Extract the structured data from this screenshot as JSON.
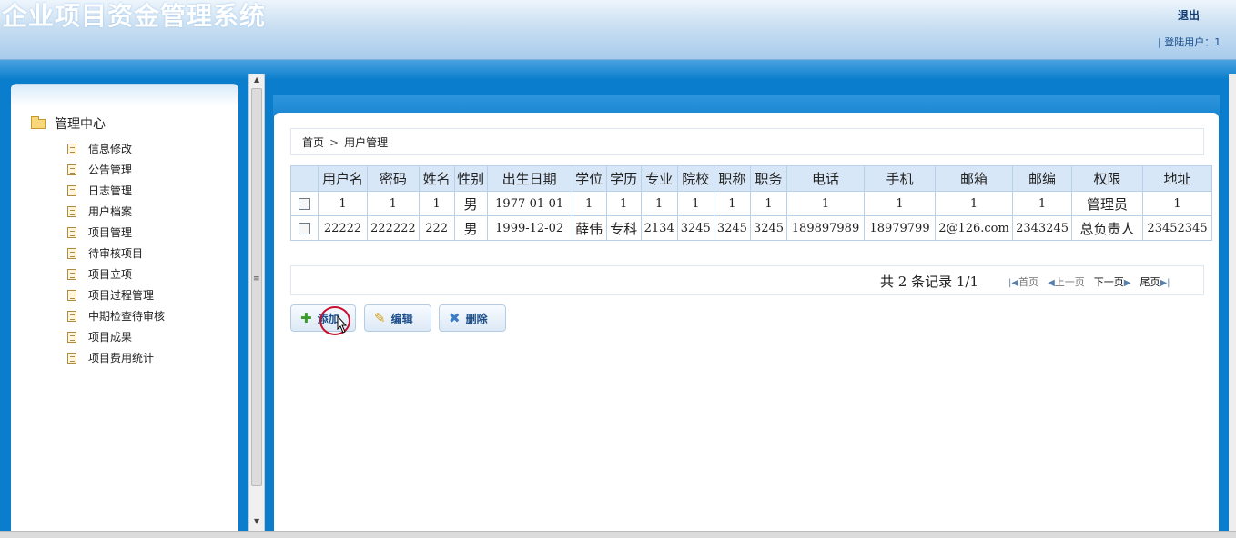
{
  "header": {
    "title": "企业项目资金管理系统",
    "logout_label": "退出",
    "login_user_text": "| 登陆用户：1"
  },
  "sidebar": {
    "root_label": "管理中心",
    "items": [
      {
        "label": "信息修改"
      },
      {
        "label": "公告管理"
      },
      {
        "label": "日志管理"
      },
      {
        "label": "用户档案"
      },
      {
        "label": "项目管理"
      },
      {
        "label": "待审核项目"
      },
      {
        "label": "项目立项"
      },
      {
        "label": "项目过程管理"
      },
      {
        "label": "中期检查待审核"
      },
      {
        "label": "项目成果"
      },
      {
        "label": "项目费用统计"
      }
    ]
  },
  "breadcrumb": {
    "home": "首页",
    "separator": ">",
    "current": "用户管理"
  },
  "table": {
    "headers": [
      "用户名",
      "密码",
      "姓名",
      "性别",
      "出生日期",
      "学位",
      "学历",
      "专业",
      "院校",
      "职称",
      "职务",
      "电话",
      "手机",
      "邮箱",
      "邮编",
      "权限",
      "地址"
    ],
    "rows": [
      [
        "1",
        "1",
        "1",
        "男",
        "1977-01-01",
        "1",
        "1",
        "1",
        "1",
        "1",
        "1",
        "1",
        "1",
        "1",
        "1",
        "管理员",
        "1"
      ],
      [
        "22222",
        "222222",
        "222",
        "男",
        "1999-12-02",
        "薛伟",
        "专科",
        "2134",
        "3245",
        "3245",
        "3245",
        "189897989",
        "18979799",
        "2@126.com",
        "2343245",
        "总负责人",
        "23452345"
      ]
    ]
  },
  "pager": {
    "info": "共 2 条记录 1/1",
    "first": "首页",
    "prev": "上一页",
    "next": "下一页",
    "last": "尾页"
  },
  "actions": {
    "add": "添加",
    "edit": "编辑",
    "delete": "删除"
  },
  "colors": {
    "header_gradient_top": "#eef5fc",
    "band_blue": "#0a7dcc",
    "table_header_bg": "#d7e7f7",
    "button_text": "#1d4f8a"
  }
}
